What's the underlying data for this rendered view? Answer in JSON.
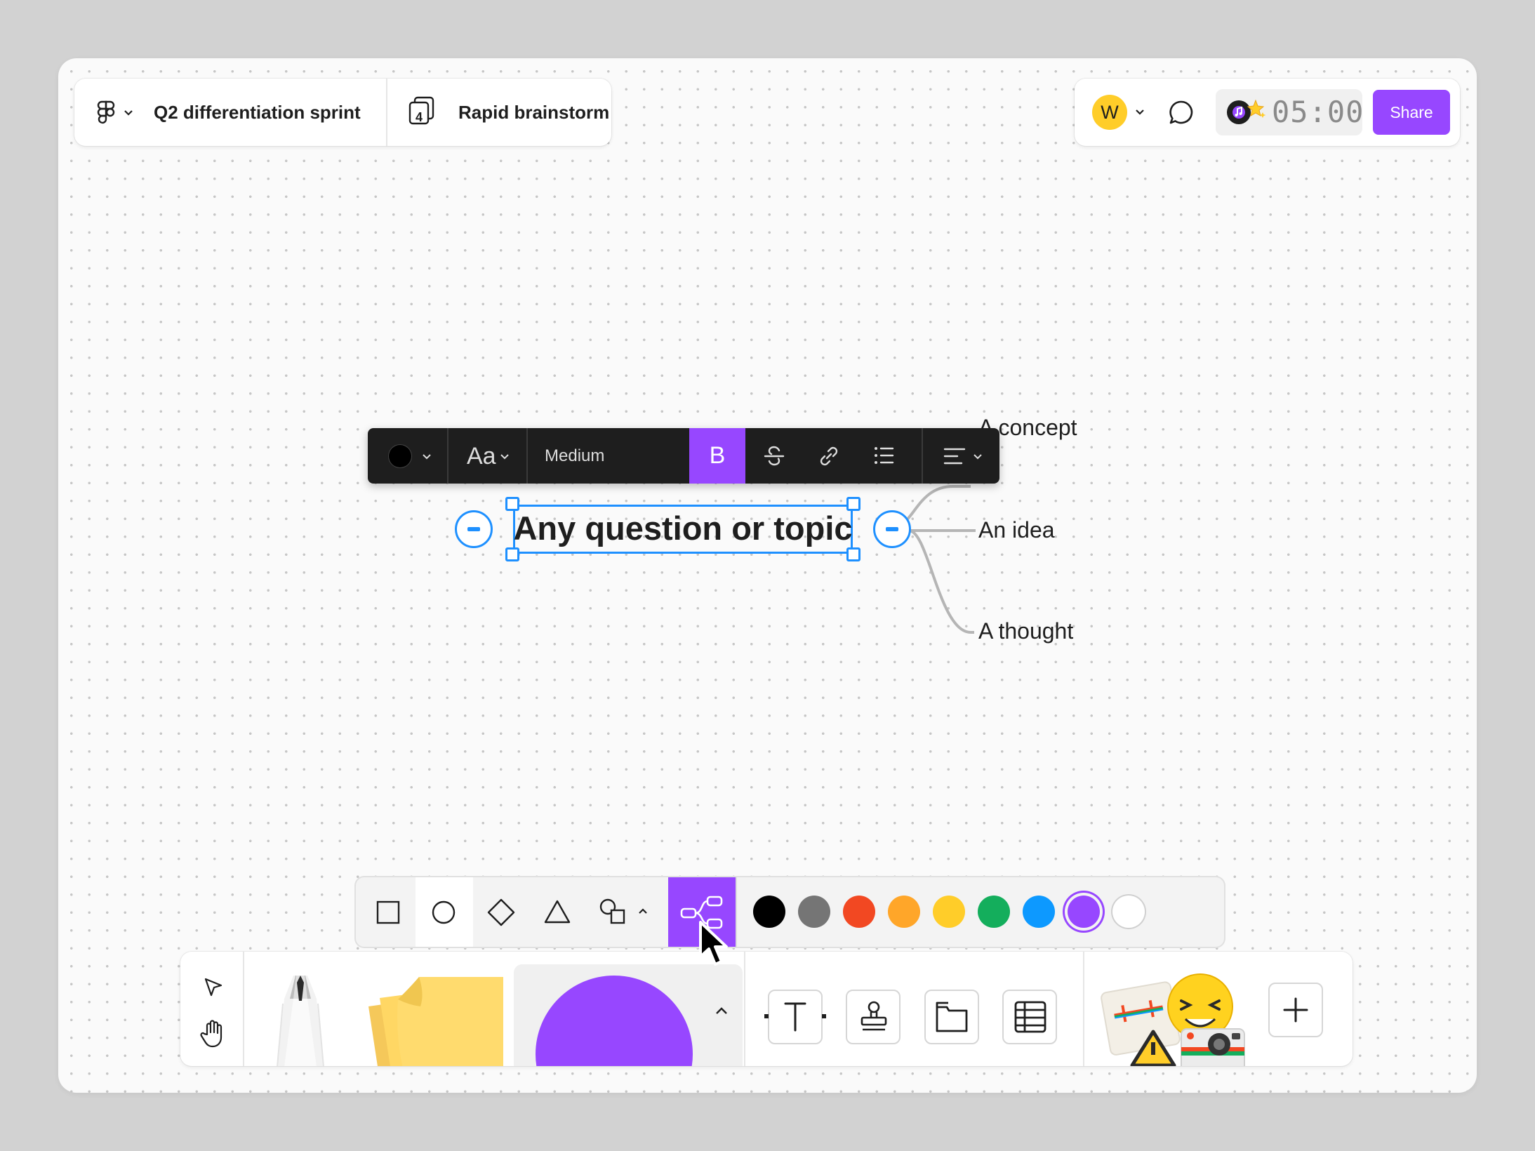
{
  "header": {
    "file_name": "Q2 differentiation sprint",
    "page_count": "4",
    "page_name": "Rapid brainstorm",
    "avatar_initial": "W",
    "timer": "05:00",
    "share_label": "Share"
  },
  "text_toolbar": {
    "font_label": "Aa",
    "size_label": "Medium",
    "bold_label": "B"
  },
  "mindmap": {
    "root": "Any question or topic",
    "branches": [
      "A concept",
      "An idea",
      "A thought"
    ]
  },
  "colors": {
    "accent": "#9747ff",
    "selection": "#1e90ff",
    "swatches": [
      "#000000",
      "#757575",
      "#f24822",
      "#ffa629",
      "#ffcd29",
      "#14ae5c",
      "#0d99ff",
      "#9747ff",
      "#ffffff"
    ],
    "selected_swatch": "#9747ff"
  },
  "icons": [
    "figma-logo-icon",
    "chevron-down-icon",
    "pages-icon",
    "comment-icon",
    "music-icon",
    "sparkle-icon",
    "rectangle-icon",
    "ellipse-icon",
    "diamond-icon",
    "triangle-icon",
    "more-shapes-icon",
    "chevron-up-icon",
    "mindmap-icon",
    "move-icon",
    "hand-icon",
    "pencil-icon",
    "sticky-note-icon",
    "shape-icon",
    "text-icon",
    "stamp-icon",
    "section-icon",
    "table-icon",
    "plus-icon",
    "bold-icon",
    "strikethrough-icon",
    "link-icon",
    "list-icon",
    "align-icon",
    "cursor-icon"
  ]
}
